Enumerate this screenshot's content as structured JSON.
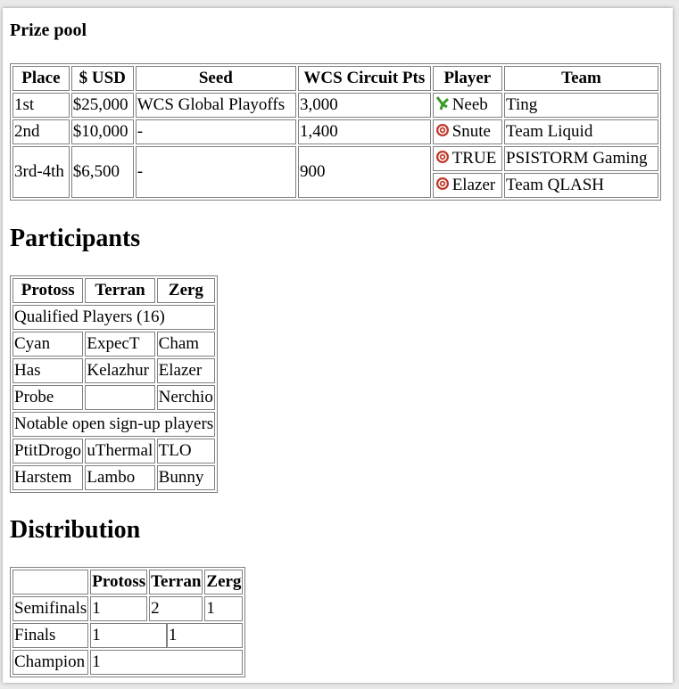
{
  "prize_pool": {
    "heading": "Prize pool",
    "columns": [
      "Place",
      "$ USD",
      "Seed",
      "WCS Circuit Pts",
      "Player",
      "Team"
    ],
    "rows": [
      {
        "place": "1st",
        "usd": "$25,000",
        "seed": "WCS Global Playoffs",
        "pts": "3,000",
        "player": "Neeb",
        "race_icon": "protoss-icon",
        "team": "Ting"
      },
      {
        "place": "2nd",
        "usd": "$10,000",
        "seed": "-",
        "pts": "1,400",
        "player": "Snute",
        "race_icon": "zerg-icon",
        "team": "Team Liquid"
      },
      {
        "place": "3rd-4th",
        "usd": "$6,500",
        "seed": "-",
        "pts": "900",
        "player": "TRUE",
        "race_icon": "zerg-icon",
        "team": "PSISTORM Gaming"
      },
      {
        "player": "Elazer",
        "race_icon": "zerg-icon",
        "team": "Team QLASH"
      }
    ]
  },
  "participants": {
    "heading": "Participants",
    "columns": [
      "Protoss",
      "Terran",
      "Zerg"
    ],
    "qualified_label": "Qualified Players (16)",
    "qualified_rows": [
      [
        "Cyan",
        "ExpecT",
        "Cham"
      ],
      [
        "Has",
        "Kelazhur",
        "Elazer"
      ],
      [
        "Probe",
        "",
        "Nerchio"
      ]
    ],
    "notable_label": "Notable open sign-up players",
    "notable_rows": [
      [
        "PtitDrogo",
        "uThermal",
        "TLO"
      ],
      [
        "Harstem",
        "Lambo",
        "Bunny"
      ]
    ]
  },
  "distribution": {
    "heading": "Distribution",
    "columns": [
      "",
      "Protoss",
      "Terran",
      "Zerg"
    ],
    "rows": [
      {
        "label": "Semifinals",
        "values": [
          "1",
          "2",
          "1"
        ]
      },
      {
        "label": "Finals",
        "values": [
          "1",
          "1"
        ]
      },
      {
        "label": "Champion",
        "values": [
          "1"
        ]
      }
    ]
  },
  "colors": {
    "border": "#808080",
    "protoss": "#3a9b2a",
    "zerg": "#c0392b"
  }
}
